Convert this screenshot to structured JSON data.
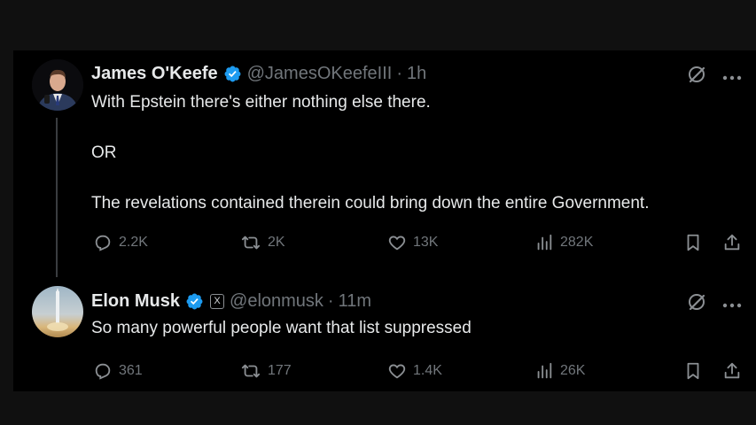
{
  "tweets": [
    {
      "author": "James O'Keefe",
      "handle": "@JamesOKeefeIII",
      "time": "1h",
      "lines": [
        "With Epstein there's either nothing else there.",
        "OR",
        "The revelations contained therein could bring down the entire Government."
      ],
      "stats": {
        "replies": "2.2K",
        "reposts": "2K",
        "likes": "13K",
        "views": "282K"
      }
    },
    {
      "author": "Elon Musk",
      "handle": "@elonmusk",
      "time": "11m",
      "affiliate_badge": "X",
      "lines": [
        "So many powerful people want that list suppressed"
      ],
      "stats": {
        "replies": "361",
        "reposts": "177",
        "likes": "1.4K",
        "views": "26K"
      }
    }
  ],
  "separator": "·",
  "colors": {
    "background": "#000000",
    "text": "#e7e9ea",
    "muted": "#71767b",
    "verified": "#1d9bf0"
  },
  "icons": [
    "verified-badge-icon",
    "grok-icon",
    "more-icon",
    "reply-icon",
    "repost-icon",
    "like-icon",
    "views-icon",
    "bookmark-icon",
    "share-icon"
  ]
}
